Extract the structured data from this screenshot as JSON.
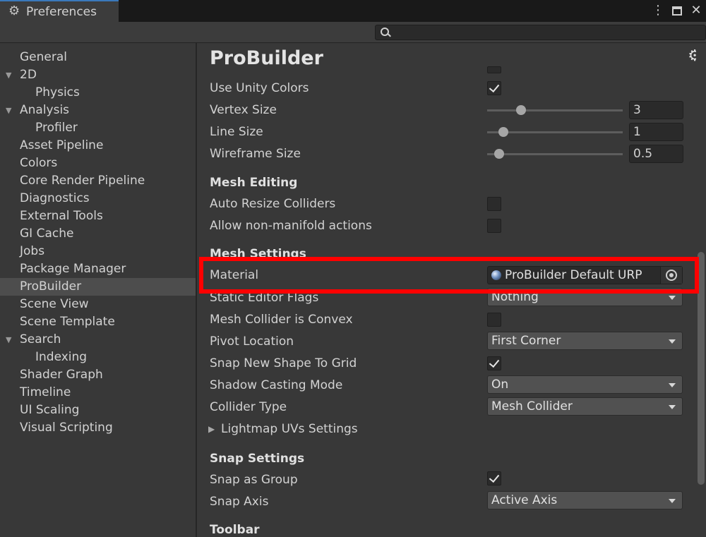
{
  "window": {
    "tab_title": "Preferences",
    "tab_icon": "gear-icon",
    "menu_icon": "kebab-menu-icon",
    "maximize_icon": "maximize-icon",
    "close_icon": "close-icon"
  },
  "search": {
    "placeholder": "",
    "value": "",
    "icon": "search-icon"
  },
  "sidebar": {
    "selected": "ProBuilder",
    "items": [
      {
        "label": "General",
        "indent": 0,
        "caret": false
      },
      {
        "label": "2D",
        "indent": 0,
        "caret": true
      },
      {
        "label": "Physics",
        "indent": 1,
        "caret": false
      },
      {
        "label": "Analysis",
        "indent": 0,
        "caret": true
      },
      {
        "label": "Profiler",
        "indent": 1,
        "caret": false
      },
      {
        "label": "Asset Pipeline",
        "indent": 0,
        "caret": false
      },
      {
        "label": "Colors",
        "indent": 0,
        "caret": false
      },
      {
        "label": "Core Render Pipeline",
        "indent": 0,
        "caret": false
      },
      {
        "label": "Diagnostics",
        "indent": 0,
        "caret": false
      },
      {
        "label": "External Tools",
        "indent": 0,
        "caret": false
      },
      {
        "label": "GI Cache",
        "indent": 0,
        "caret": false
      },
      {
        "label": "Jobs",
        "indent": 0,
        "caret": false
      },
      {
        "label": "Package Manager",
        "indent": 0,
        "caret": false
      },
      {
        "label": "ProBuilder",
        "indent": 0,
        "caret": false
      },
      {
        "label": "Scene View",
        "indent": 0,
        "caret": false
      },
      {
        "label": "Scene Template",
        "indent": 0,
        "caret": false
      },
      {
        "label": "Search",
        "indent": 0,
        "caret": true
      },
      {
        "label": "Indexing",
        "indent": 1,
        "caret": false
      },
      {
        "label": "Shader Graph",
        "indent": 0,
        "caret": false
      },
      {
        "label": "Timeline",
        "indent": 0,
        "caret": false
      },
      {
        "label": "UI Scaling",
        "indent": 0,
        "caret": false
      },
      {
        "label": "Visual Scripting",
        "indent": 0,
        "caret": false
      }
    ]
  },
  "content": {
    "title": "ProBuilder",
    "settings_icon": "gear-icon",
    "rows": {
      "use_unity_colors": {
        "label": "Use Unity Colors",
        "checked": true
      },
      "vertex_size": {
        "label": "Vertex Size",
        "value": "3",
        "level": 0.25
      },
      "line_size": {
        "label": "Line Size",
        "value": "1",
        "level": 0.12
      },
      "wireframe_size": {
        "label": "Wireframe Size",
        "value": "0.5",
        "level": 0.09
      },
      "mesh_editing": {
        "label": "Mesh Editing"
      },
      "auto_resize": {
        "label": "Auto Resize Colliders",
        "checked": false
      },
      "non_manifold": {
        "label": "Allow non-manifold actions",
        "checked": false
      },
      "mesh_settings": {
        "label": "Mesh Settings"
      },
      "material": {
        "label": "Material",
        "value": "ProBuilder Default URP",
        "icon": "material-sphere-icon",
        "picker_icon": "object-picker-icon"
      },
      "static_flags": {
        "label": "Static Editor Flags",
        "value": "Nothing"
      },
      "convex": {
        "label": "Mesh Collider is Convex",
        "checked": false
      },
      "pivot": {
        "label": "Pivot Location",
        "value": "First Corner"
      },
      "snap_new_shape": {
        "label": "Snap New Shape To Grid",
        "checked": true
      },
      "shadow_mode": {
        "label": "Shadow Casting Mode",
        "value": "On"
      },
      "collider_type": {
        "label": "Collider Type",
        "value": "Mesh Collider"
      },
      "lightmap": {
        "label": "Lightmap UVs Settings"
      },
      "snap_settings": {
        "label": "Snap Settings"
      },
      "snap_group": {
        "label": "Snap as Group",
        "checked": true
      },
      "snap_axis": {
        "label": "Snap Axis",
        "value": "Active Axis"
      },
      "toolbar": {
        "label": "Toolbar"
      }
    }
  },
  "colors": {
    "highlight": "#ff0000",
    "background": "#383838",
    "selection": "#4d4d4d",
    "tab_accent": "#3a79bb"
  }
}
